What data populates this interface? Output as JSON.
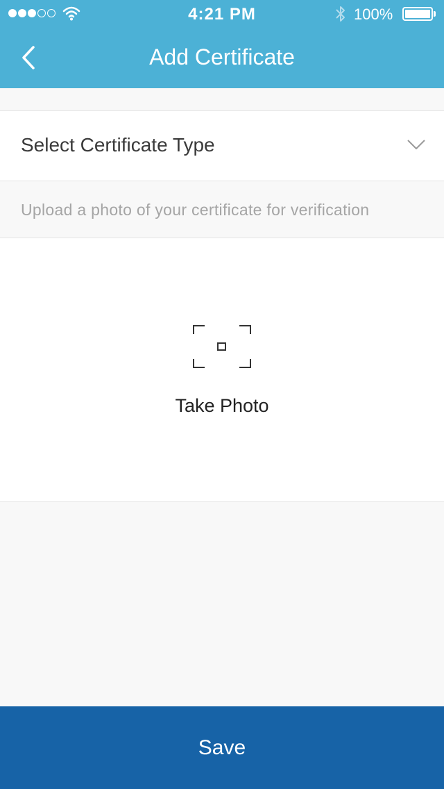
{
  "status_bar": {
    "time": "4:21 PM",
    "battery": "100%",
    "signal_dots": [
      true,
      true,
      true,
      false,
      false
    ]
  },
  "nav": {
    "title": "Add Certificate"
  },
  "form": {
    "select_label": "Select Certificate Type",
    "hint": "Upload a photo of your certificate for verification",
    "photo_label": "Take Photo",
    "save_label": "Save"
  },
  "colors": {
    "header": "#4cb1d6",
    "save": "#1763a7",
    "background": "#f8f8f8"
  },
  "icons": [
    "back-arrow-icon",
    "wifi-icon",
    "bluetooth-icon",
    "battery-icon",
    "chevron-down-icon",
    "camera-frame-icon"
  ]
}
